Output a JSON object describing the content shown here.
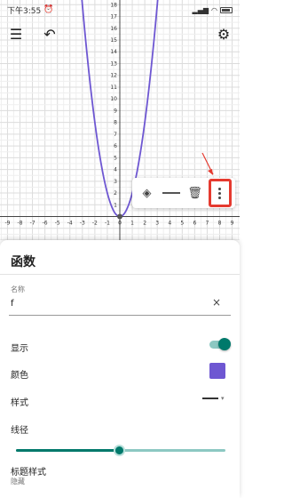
{
  "status_bar": {
    "time": "下午3:55",
    "alarm_icon": "alarm-icon",
    "right_text": "...",
    "signal_icons": [
      "signal-icon",
      "signal-icon",
      "wifi-icon"
    ],
    "battery_icon": "battery-icon"
  },
  "header": {
    "menu_icon": "menu-icon",
    "undo_icon": "undo-icon",
    "settings_icon": "gear-icon"
  },
  "graph": {
    "x_ticks": [
      "-9",
      "-8",
      "-7",
      "-6",
      "-5",
      "-4",
      "-3",
      "-2",
      "-1",
      "0",
      "1",
      "2",
      "3",
      "4",
      "5",
      "6",
      "7",
      "8",
      "9"
    ],
    "y_ticks": [
      "1",
      "2",
      "3",
      "4",
      "5",
      "6",
      "7",
      "8",
      "9",
      "10",
      "11",
      "12",
      "13",
      "14",
      "15",
      "16",
      "17",
      "18"
    ],
    "x_range": [
      -9.6,
      9.6
    ],
    "y_range": [
      -2,
      18.4
    ],
    "curve": "y = 2x²",
    "curve_color": "#6e57d2",
    "point": [
      0,
      0
    ],
    "annotation_color": "#e53a2f"
  },
  "toolbar": {
    "fill_icon": "paint-bucket-icon",
    "line_icon": "line-style-icon",
    "delete_icon": "trash-icon",
    "more_icon": "more-vertical-icon"
  },
  "panel": {
    "title": "函数",
    "name_label": "名称",
    "name_value": "f",
    "clear_icon": "×",
    "show_label": "显示",
    "show_value": true,
    "color_label": "颜色",
    "color_value": "#6e57d2",
    "style_label": "样式",
    "style_chevron": "▾",
    "width_label": "线径",
    "width_fraction": 0.49,
    "caption_label": "标题样式",
    "caption_value": "隐藏"
  },
  "accent_color": "#00796b"
}
